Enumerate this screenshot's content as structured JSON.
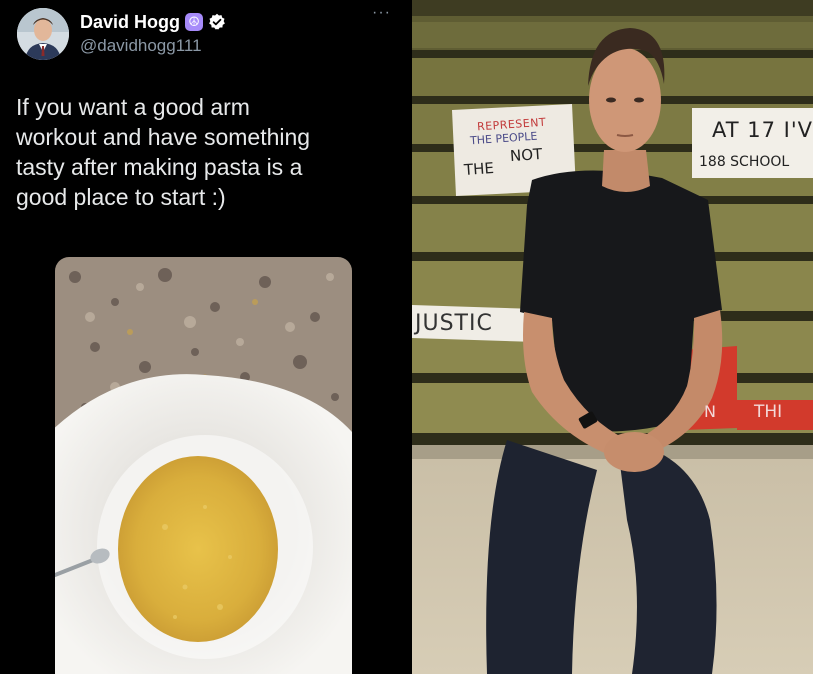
{
  "tweet": {
    "display_name": "David Hogg",
    "handle": "@davidhogg111",
    "more_label": "···",
    "peace_badge": "☮",
    "text": "If you want a good arm\nworkout and have something\ntasty after making pasta is a\ngood place to start :)"
  },
  "photo": {
    "signs": {
      "sign1_line1": "Represent",
      "sign1_line2": "The People",
      "sign1_line3": "Not",
      "sign1_line4": "The",
      "sign2_line1": "At 17 I'v",
      "sign2_line2": "188 School",
      "sign3": "Justic",
      "sign4": "Thi",
      "sign5": "N"
    }
  },
  "colors": {
    "background": "#000000",
    "text_primary": "#e7e9ea",
    "text_secondary": "#8b98a5",
    "verified_blue": "#ffffff",
    "peace_badge": "#a78bfa",
    "bleacher_green": "#6d6a3a",
    "sign_red": "#c0392b"
  },
  "icons": {
    "verified": "verified-icon",
    "peace": "peace-icon",
    "more": "more-icon"
  }
}
